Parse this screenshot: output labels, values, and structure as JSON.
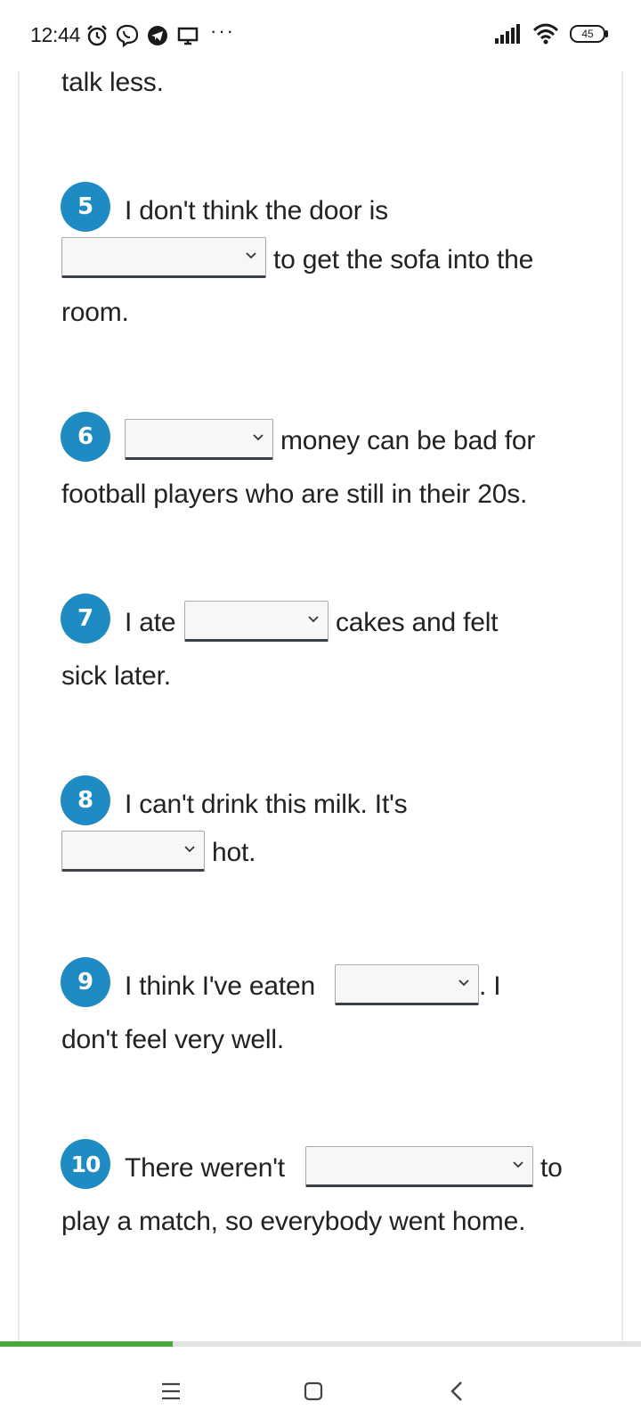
{
  "status_bar": {
    "time": "12:44",
    "left_icons": [
      "alarm-icon",
      "viber-icon",
      "telegram-icon",
      "screen-icon"
    ],
    "more": "···",
    "battery": "45"
  },
  "exercise": {
    "intro_tail": "talk less.",
    "questions": [
      {
        "number": "5",
        "line1_before": "I don't think the door is",
        "line2_after": "to get the sofa into the",
        "line3": "room.",
        "selected": ""
      },
      {
        "number": "6",
        "line1_after": "money can be bad for",
        "line2": "football players who are still in their 20s.",
        "selected": ""
      },
      {
        "number": "7",
        "line1_before": "I ate",
        "line1_after": "cakes and felt",
        "line2": "sick later.",
        "selected": ""
      },
      {
        "number": "8",
        "line1_before": "I can't drink this milk. It's",
        "line2_after": "hot.",
        "selected": ""
      },
      {
        "number": "9",
        "line1_before": "I think I've eaten",
        "line1_after": ". I",
        "line2": "don't feel very well.",
        "selected": ""
      },
      {
        "number": "10",
        "line1_before": "There weren't",
        "line1_after": "to",
        "line2": "play a match, so everybody went home.",
        "selected": ""
      }
    ]
  },
  "progress": {
    "fraction": 0.27,
    "color": "#48a83a"
  },
  "nav_bar": {
    "buttons": [
      "menu-icon",
      "home-icon",
      "back-icon"
    ]
  },
  "colors": {
    "badge": "#1f8bc3",
    "text": "#222222"
  }
}
